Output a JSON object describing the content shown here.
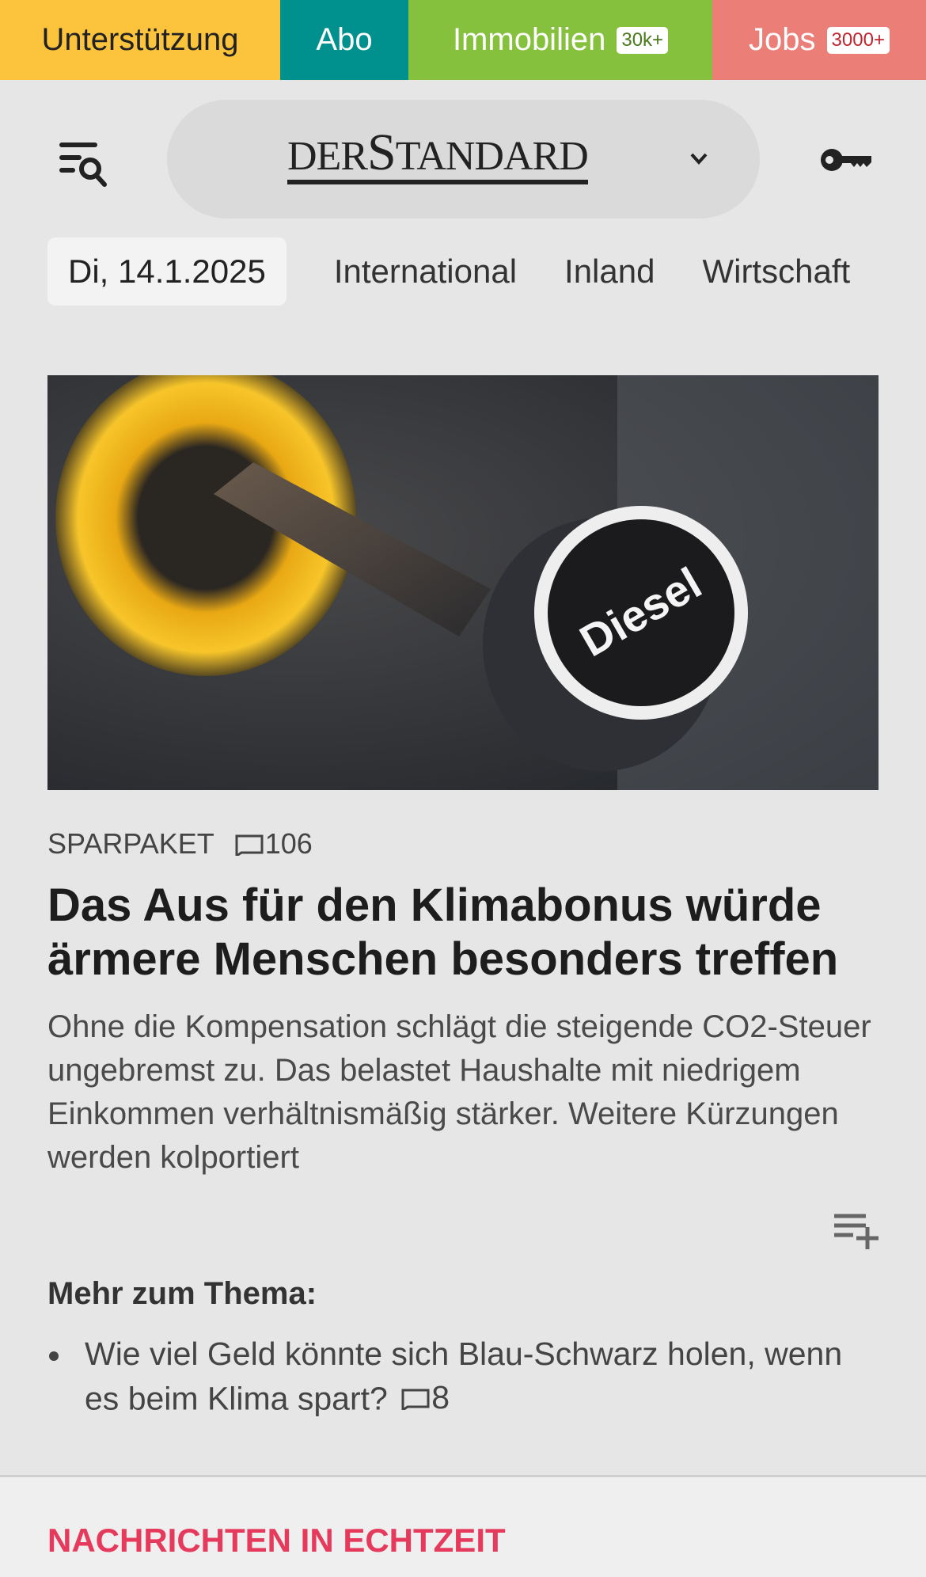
{
  "topbar": {
    "support": "Unterstützung",
    "abo": "Abo",
    "immo": "Immobilien",
    "immo_badge": "30k+",
    "jobs": "Jobs",
    "jobs_badge": "3000+"
  },
  "header": {
    "logo_small1": "DER",
    "logo_big": "S",
    "logo_small2": "TANDARD",
    "menu_icon": "menu-search-icon",
    "login_icon": "key-icon"
  },
  "nav": {
    "date": "Di, 14.1.2025",
    "items": [
      "International",
      "Inland",
      "Wirtschaft"
    ]
  },
  "article": {
    "image_label": "Diesel",
    "kicker": "SPARPAKET",
    "comments": "106",
    "title": "Das Aus für den Klimabonus würde ärmere Menschen besonders treffen",
    "lead": "Ohne die Kompensation schlägt die steigende CO2-Steuer ungebremst zu. Das belastet Haushalte mit niedrigem Einkommen verhältnismäßig stärker. Weitere Kürzungen werden kolportiert"
  },
  "more": {
    "heading": "Mehr zum Thema:",
    "items": [
      {
        "text": "Wie viel Geld könnte sich Blau-Schwarz holen, wenn es beim Klima spart?",
        "comments": "8"
      }
    ]
  },
  "live": {
    "heading": "NACHRICHTEN IN ECHTZEIT"
  },
  "colors": {
    "support": "#fcc43c",
    "abo": "#00918f",
    "immo": "#86c13d",
    "jobs": "#eb7f78",
    "live": "#e63a5c"
  }
}
